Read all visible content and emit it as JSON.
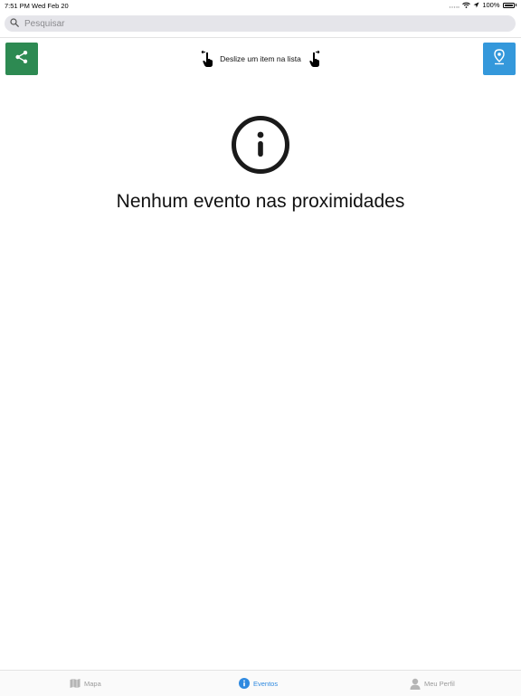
{
  "status_bar": {
    "time": "7:51 PM",
    "date": "Wed Feb 20",
    "battery": "100%"
  },
  "search": {
    "placeholder": "Pesquisar"
  },
  "toolbar": {
    "swipe_hint": "Deslize um item na lista"
  },
  "empty_state": {
    "message": "Nenhum evento nas proximidades"
  },
  "tabs": [
    {
      "label": "Mapa",
      "icon": "map-icon",
      "active": false
    },
    {
      "label": "Eventos",
      "icon": "info-icon",
      "active": true
    },
    {
      "label": "Meu Perfil",
      "icon": "person-icon",
      "active": false
    }
  ],
  "colors": {
    "share_button": "#2d8a52",
    "location_button": "#3498db",
    "active_tab": "#2f8ae0",
    "inactive_tab": "#9a9a9a"
  }
}
